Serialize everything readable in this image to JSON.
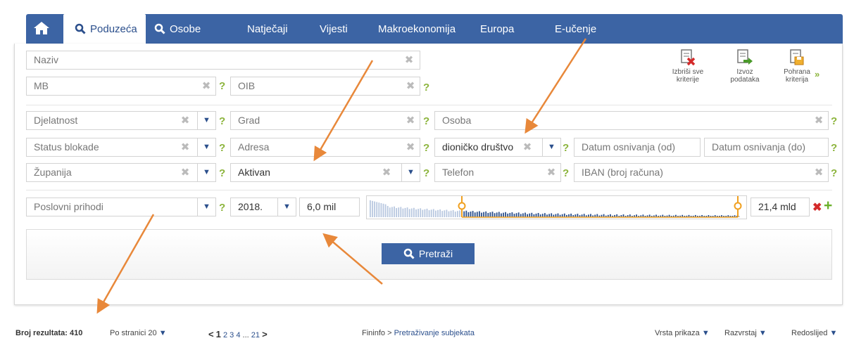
{
  "nav": {
    "tabs": [
      "Poduzeća",
      "Osobe",
      "Natječaji",
      "Vijesti",
      "Makroekonomija",
      "Europa",
      "E-učenje"
    ]
  },
  "fields": {
    "naziv": "Naziv",
    "mb": "MB",
    "oib": "OIB",
    "djelatnost": "Djelatnost",
    "grad": "Grad",
    "osoba": "Osoba",
    "status_blokade": "Status blokade",
    "adresa": "Adresa",
    "pravni_oblik": "dioničko društvo",
    "datum_od": "Datum osnivanja (od)",
    "datum_do": "Datum osnivanja (do)",
    "zupanija": "Županija",
    "aktivan": "Aktivan",
    "telefon": "Telefon",
    "iban": "IBAN (broj računa)",
    "poslovni_prihodi": "Poslovni prihodi",
    "godina": "2018.",
    "min": "6,0 mil",
    "max": "21,4 mld"
  },
  "tools": {
    "clear": [
      "Izbriši sve",
      "kriterije"
    ],
    "export": [
      "Izvoz",
      "podataka"
    ],
    "save": [
      "Pohrana",
      "kriterija"
    ]
  },
  "search_button": "Pretraži",
  "footer": {
    "results_label": "Broj rezultata: 410",
    "per_page": "Po stranici 20",
    "pages": [
      "<",
      "1",
      "2",
      "3",
      "4",
      "...",
      "21",
      ">"
    ],
    "breadcrumb_root": "Fininfo",
    "breadcrumb_sep": ">",
    "breadcrumb_current": "Pretraživanje subjekata",
    "view": "Vrsta prikaza",
    "sort": "Razvrstaj",
    "order": "Redoslijed"
  },
  "colors": {
    "accent": "#3c64a4",
    "help": "#8cb43c",
    "annotation_arrow": "#e8883a"
  }
}
